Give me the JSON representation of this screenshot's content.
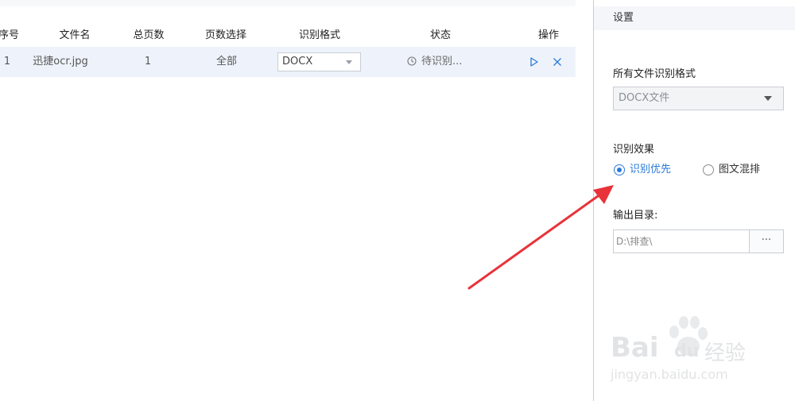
{
  "file_list": {
    "columns": {
      "index": "序号",
      "file_name": "文件名",
      "total_pages": "总页数",
      "page_select": "页数选择",
      "format": "识别格式",
      "status": "状态",
      "actions": "操作"
    },
    "rows": [
      {
        "index": "1",
        "file_name": "迅捷ocr.jpg",
        "total_pages": "1",
        "page_select": "全部",
        "format": "DOCX",
        "status": "待识别..."
      }
    ]
  },
  "settings": {
    "title": "设置",
    "all_format_label": "所有文件识别格式",
    "all_format_value": "DOCX文件",
    "effect_label": "识别效果",
    "effect_options": [
      "识别优先",
      "图文混排"
    ],
    "effect_selected": "识别优先",
    "output_label": "输出目录:",
    "output_path": "D:\\排查\\",
    "browse_label": "···"
  },
  "watermark": {
    "brand": "Bai",
    "brand_suffix": "du",
    "brand_cn": "经验",
    "url": "jingyan.baidu.com"
  },
  "colors": {
    "accent": "#2a7ad9",
    "row_highlight": "#eef3fb",
    "annotation_arrow": "#e8333a"
  }
}
